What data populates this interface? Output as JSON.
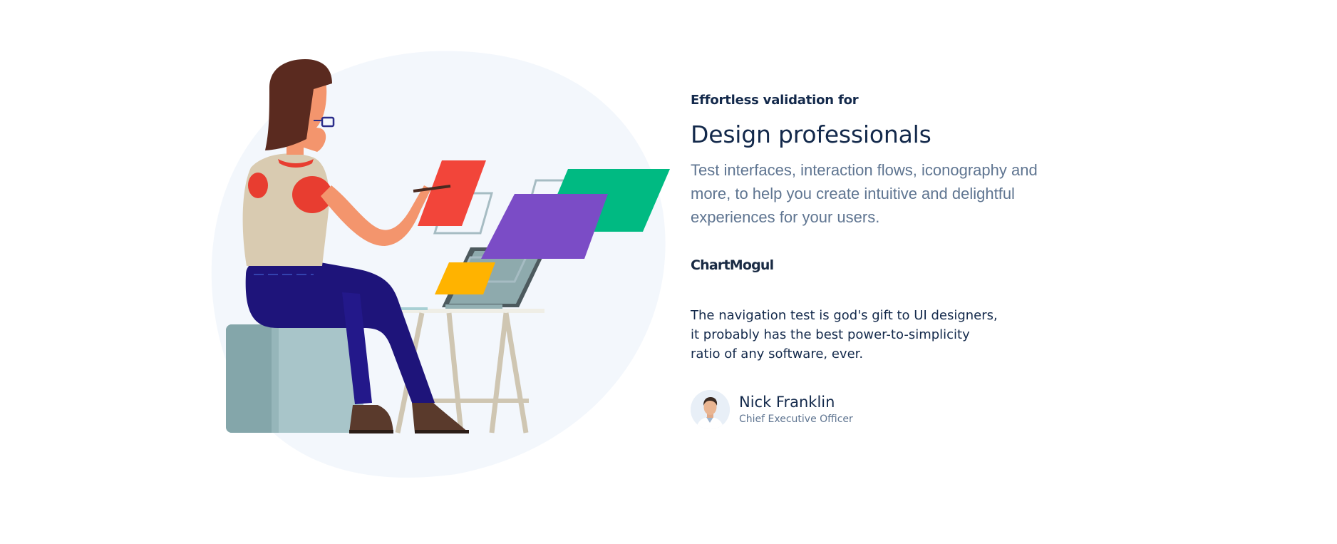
{
  "section": {
    "eyebrow": "Effortless validation for",
    "title": "Design professionals",
    "description": "Test interfaces, interaction flows, iconography and more, to help you create intuitive and delightful experiences for your users.",
    "brand_logo": "ChartMogul",
    "quote_lines": [
      "The navigation test is god's gift to UI designers,",
      "it probably has the best power-to-simplicity",
      "ratio of any software, ever."
    ],
    "person": {
      "name": "Nick Franklin",
      "role": "Chief Executive Officer"
    }
  },
  "colors": {
    "heading": "#13294b",
    "body_text": "#5f7591",
    "blob_background": "#f3f7fc",
    "card_red": "#f2453a",
    "card_purple": "#7b4cc6",
    "card_green": "#00ba82",
    "card_yellow": "#ffb300"
  },
  "icons": [
    "designer-illustration",
    "avatar-photo"
  ]
}
